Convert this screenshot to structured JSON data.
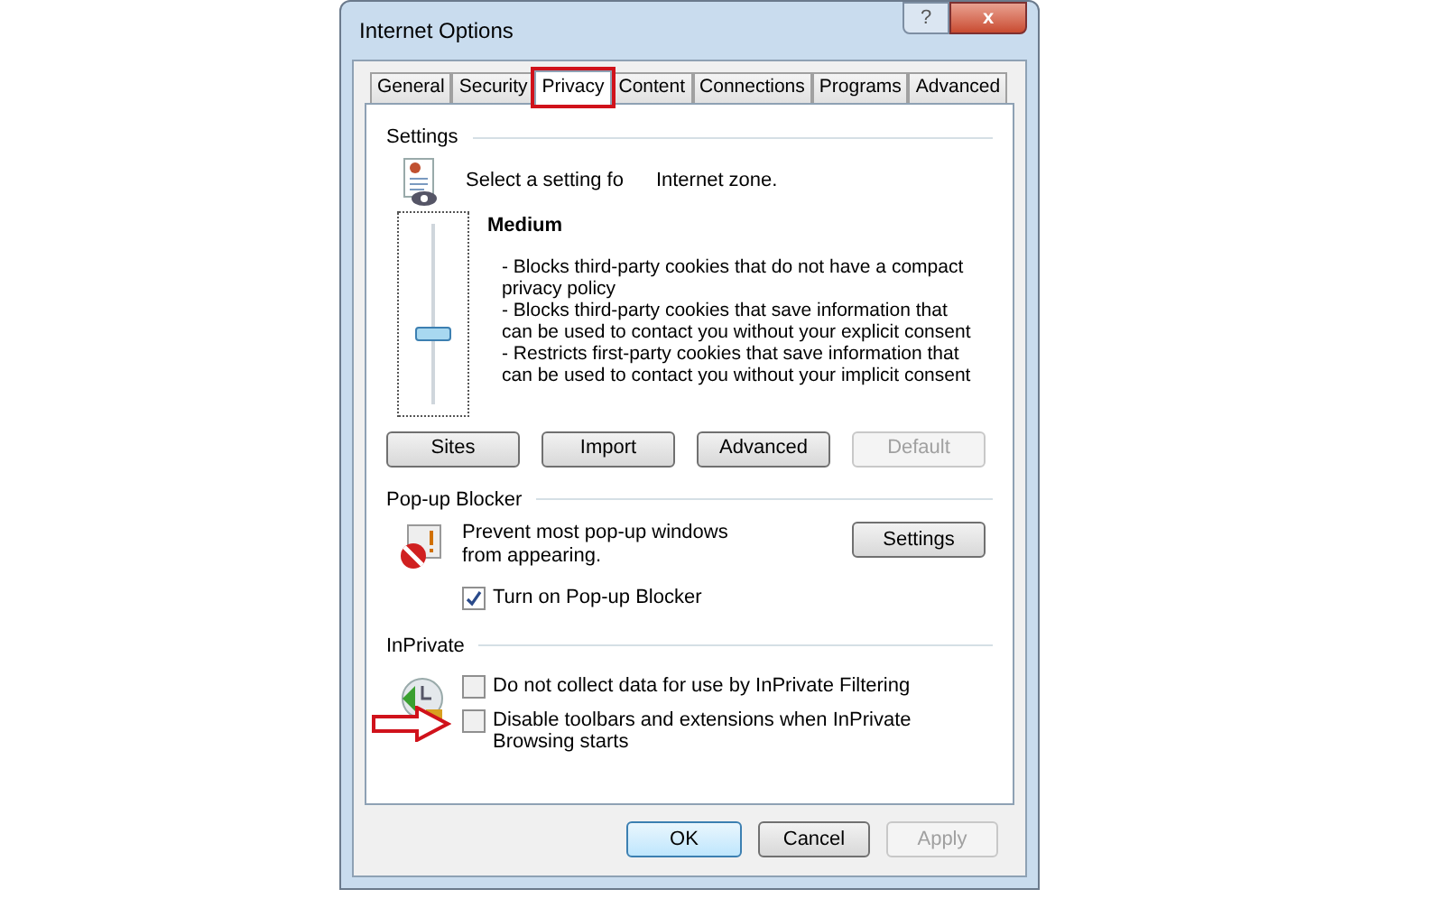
{
  "window": {
    "title": "Internet Options",
    "help": "?",
    "close": "x"
  },
  "tabs": [
    {
      "label": "General",
      "selected": false,
      "highlighted": false
    },
    {
      "label": "Security",
      "selected": false,
      "highlighted": false
    },
    {
      "label": "Privacy",
      "selected": true,
      "highlighted": true
    },
    {
      "label": "Content",
      "selected": false,
      "highlighted": false
    },
    {
      "label": "Connections",
      "selected": false,
      "highlighted": false
    },
    {
      "label": "Programs",
      "selected": false,
      "highlighted": false
    },
    {
      "label": "Advanced",
      "selected": false,
      "highlighted": false
    }
  ],
  "settings": {
    "heading": "Settings",
    "intro": "Select a setting fo",
    "zone": "Internet zone.",
    "slider": {
      "level": 0.4
    },
    "level_name": "Medium",
    "description": [
      "- Blocks third-party cookies that do not have a compact privacy policy",
      "- Blocks third-party cookies that save information that can be used to contact you without your explicit consent",
      "- Restricts first-party cookies that save information that can be used to contact you without your implicit consent"
    ],
    "buttons": [
      {
        "label": "Sites",
        "disabled": false
      },
      {
        "label": "Import",
        "disabled": false
      },
      {
        "label": "Advanced",
        "disabled": false
      },
      {
        "label": "Default",
        "disabled": true
      }
    ]
  },
  "popup_blocker": {
    "heading": "Pop-up Blocker",
    "text": "Prevent most pop-up windows from appearing.",
    "button": {
      "label": "Settings",
      "disabled": false
    },
    "checkbox": {
      "label": "Turn on Pop-up Blocker",
      "checked": true
    }
  },
  "inprivate": {
    "heading": "InPrivate",
    "options": [
      {
        "label": "Do not collect data for use by InPrivate Filtering",
        "checked": false,
        "pointed": false
      },
      {
        "label": "Disable toolbars and extensions when InPrivate Browsing starts",
        "checked": false,
        "pointed": true
      }
    ]
  },
  "buttons": [
    {
      "label": "OK",
      "disabled": false,
      "default": true
    },
    {
      "label": "Cancel",
      "disabled": false,
      "default": false
    },
    {
      "label": "Apply",
      "disabled": true,
      "default": false
    }
  ]
}
